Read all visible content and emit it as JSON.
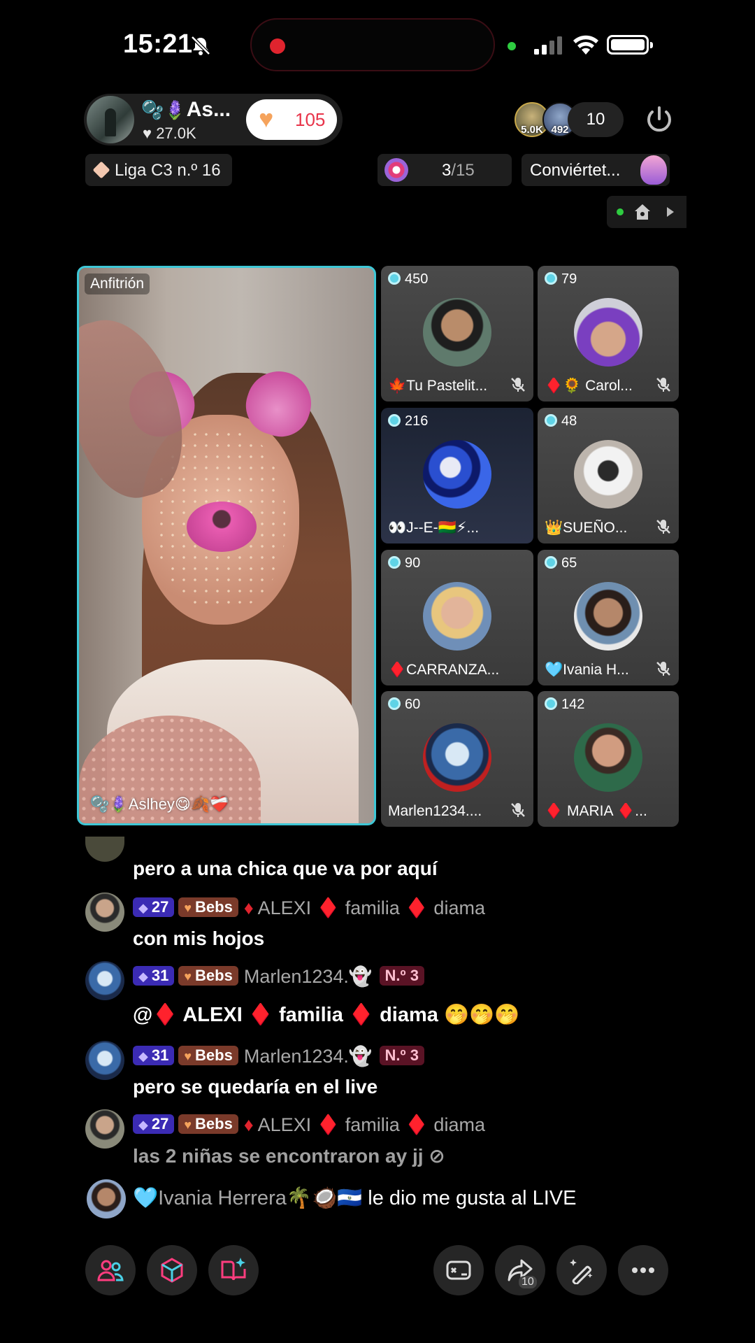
{
  "status_bar": {
    "time": "15:21"
  },
  "host": {
    "name": "As...",
    "likes": "27.0K",
    "follow_count": "105",
    "video_tag": "Anfitrión",
    "video_caption": "Aslhey😋🍂❤️‍🩹"
  },
  "viewers": {
    "avatar1_label": "5.0K",
    "avatar2_label": "492",
    "count": "10"
  },
  "league": {
    "label": "Liga C3 n.º 16"
  },
  "goal": {
    "current": "3",
    "total": "/15"
  },
  "convert": {
    "label": "Conviértet..."
  },
  "guests": [
    {
      "score": "450",
      "name": "🍁Tu Pastelit..."
    },
    {
      "score": "79",
      "name": "♦️🌻 Carol..."
    },
    {
      "score": "216",
      "name": "👀J--E-🇧🇴⚡..."
    },
    {
      "score": "48",
      "name": "👑SUEÑO..."
    },
    {
      "score": "90",
      "name": "♦️CARRANZA..."
    },
    {
      "score": "65",
      "name": "🩵Ivania H..."
    },
    {
      "score": "60",
      "name": "Marlen1234...."
    },
    {
      "score": "142",
      "name": "♦️ MARIA ♦️..."
    }
  ],
  "chat": {
    "partial_message": "pero a una chica que va por aquí",
    "messages": [
      {
        "level": "27",
        "fan_badge": "Bebs",
        "user": "ALEXI ♦️ familia ♦️ diama",
        "text": "con mis hojos"
      },
      {
        "level": "31",
        "fan_badge": "Bebs",
        "user": "Marlen1234.👻",
        "rank": "N.º 3",
        "text": "@♦️ ALEXI ♦️ familia ♦️ diama 🤭🤭🤭"
      },
      {
        "level": "31",
        "fan_badge": "Bebs",
        "user": "Marlen1234.👻",
        "rank": "N.º 3",
        "text": "pero se quedaría en el live"
      },
      {
        "level": "27",
        "fan_badge": "Bebs",
        "user": "ALEXI ♦️ familia ♦️ diama",
        "text": "las 2 niñas se encontraron ay jj"
      }
    ],
    "join_notice": {
      "user": "🩵Ivania Herrera🌴🥥🇸🇻",
      "action": "le dio me gusta al LIVE"
    }
  },
  "bottom_bar": {
    "share_count": "10"
  },
  "colors": {
    "accent_cyan": "#3ec7d6",
    "like_red": "#e8344a",
    "level_badge": "#3b2bb4"
  }
}
